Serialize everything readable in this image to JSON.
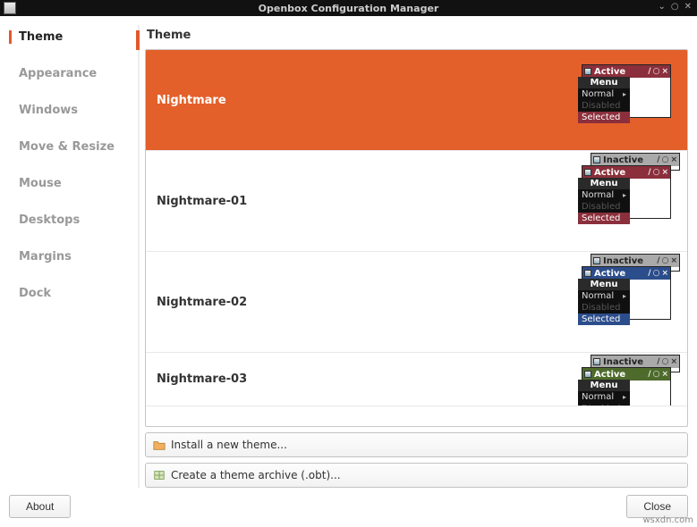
{
  "window": {
    "title": "Openbox Configuration Manager",
    "controls": {
      "min": "⌄",
      "max": "✕",
      "close": "○"
    }
  },
  "sidebar": {
    "items": [
      {
        "label": "Theme",
        "active": true
      },
      {
        "label": "Appearance"
      },
      {
        "label": "Windows"
      },
      {
        "label": "Move & Resize"
      },
      {
        "label": "Mouse"
      },
      {
        "label": "Desktops"
      },
      {
        "label": "Margins"
      },
      {
        "label": "Dock"
      }
    ]
  },
  "content": {
    "section_title": "Theme",
    "themes": [
      {
        "name": "Nightmare",
        "selected": true,
        "accent": "#8b2f3c",
        "inactive_visible": false
      },
      {
        "name": "Nightmare-01",
        "selected": false,
        "accent": "#8b2f3c",
        "inactive_visible": true
      },
      {
        "name": "Nightmare-02",
        "selected": false,
        "accent": "#2c4d8b",
        "inactive_visible": true
      },
      {
        "name": "Nightmare-03",
        "selected": false,
        "accent": "#4e6b2c",
        "inactive_visible": true
      }
    ],
    "preview_strings": {
      "active": "Active",
      "inactive": "Inactive",
      "menu": "Menu",
      "normal": "Normal",
      "disabled": "Disabled",
      "selected": "Selected"
    },
    "install_label": "Install a new theme...",
    "archive_label": "Create a theme archive (.obt)..."
  },
  "footer": {
    "about": "About",
    "close": "Close"
  },
  "watermark": "wsxdn.com"
}
